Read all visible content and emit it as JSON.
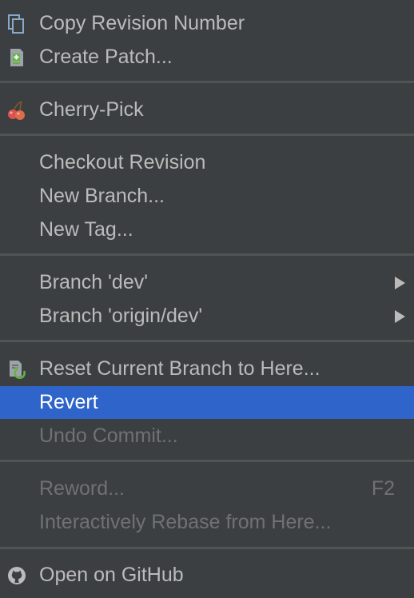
{
  "menu": {
    "items": [
      {
        "label": "Copy Revision Number",
        "icon": "copy-icon"
      },
      {
        "label": "Create Patch...",
        "icon": "patch-icon"
      },
      {
        "label": "Cherry-Pick",
        "icon": "cherry-icon"
      },
      {
        "label": "Checkout Revision"
      },
      {
        "label": "New Branch..."
      },
      {
        "label": "New Tag..."
      },
      {
        "label": "Branch 'dev'",
        "submenu": true
      },
      {
        "label": "Branch 'origin/dev'",
        "submenu": true
      },
      {
        "label": "Reset Current Branch to Here...",
        "icon": "reset-icon"
      },
      {
        "label": "Revert",
        "selected": true
      },
      {
        "label": "Undo Commit...",
        "disabled": true
      },
      {
        "label": "Reword...",
        "shortcut": "F2",
        "disabled": true
      },
      {
        "label": "Interactively Rebase from Here...",
        "disabled": true
      },
      {
        "label": "Open on GitHub",
        "icon": "github-icon"
      }
    ]
  },
  "colors": {
    "background": "#3c3f41",
    "text": "#bbbbbb",
    "disabled_text": "#6f7173",
    "selection": "#2f65ca",
    "separator": "#515355"
  }
}
